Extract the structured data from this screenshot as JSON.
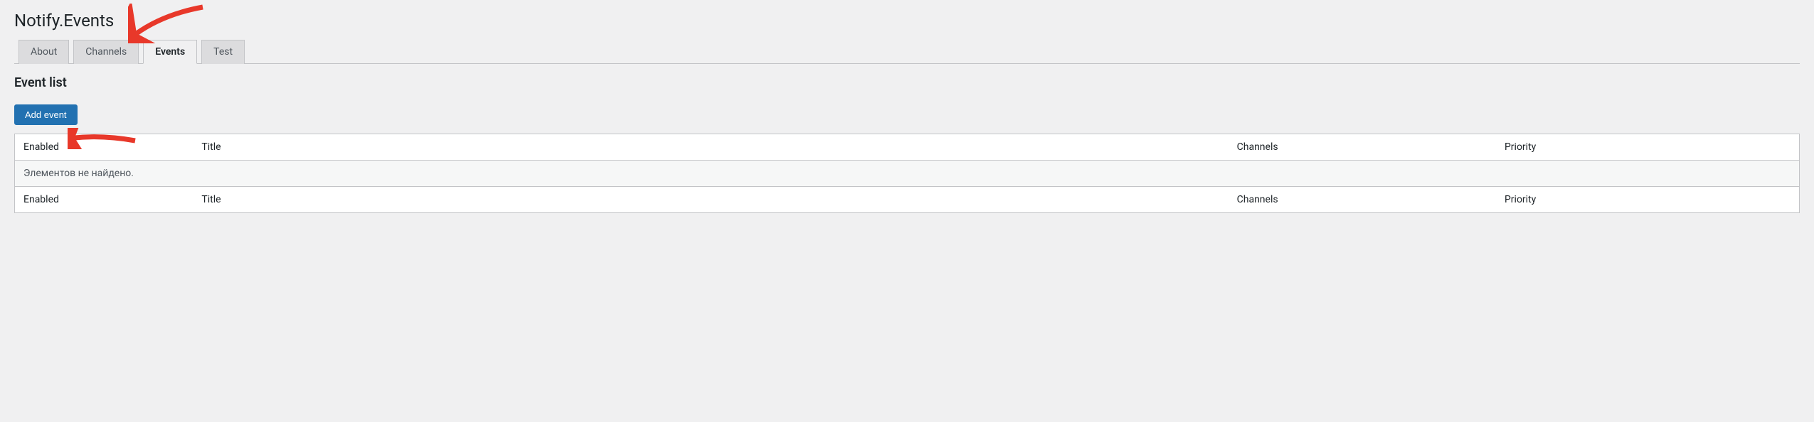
{
  "header": {
    "title": "Notify.Events"
  },
  "tabs": [
    {
      "label": "About",
      "active": false
    },
    {
      "label": "Channels",
      "active": false
    },
    {
      "label": "Events",
      "active": true
    },
    {
      "label": "Test",
      "active": false
    }
  ],
  "section": {
    "title": "Event list"
  },
  "buttons": {
    "add_event": "Add event"
  },
  "table": {
    "headers": {
      "enabled": "Enabled",
      "title": "Title",
      "channels": "Channels",
      "priority": "Priority"
    },
    "empty_message": "Элементов не найдено."
  },
  "annotations": {
    "arrow_color": "#e8382a"
  }
}
